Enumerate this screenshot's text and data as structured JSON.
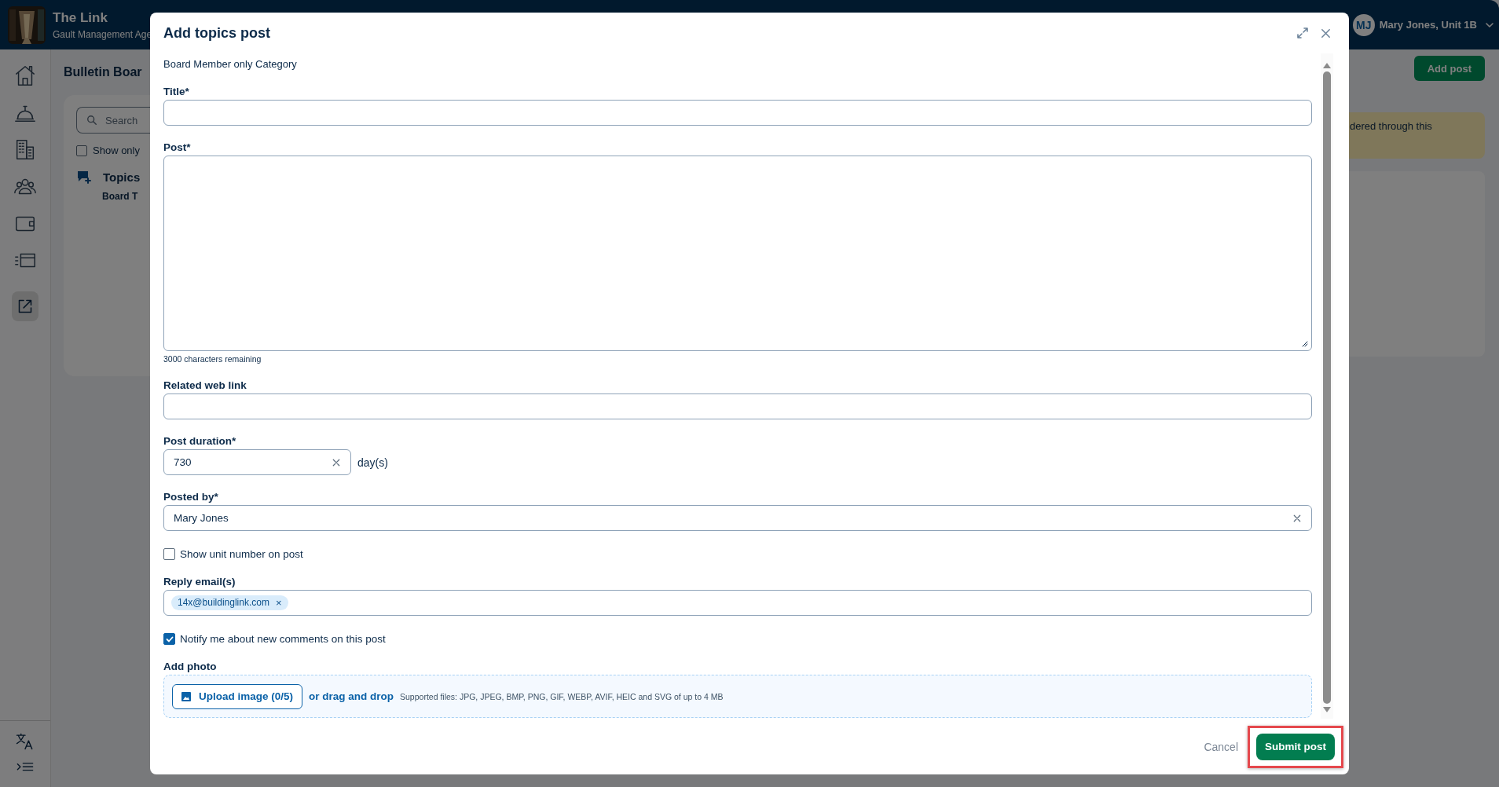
{
  "app": {
    "name": "The Link",
    "company": "Gault Management Age",
    "user": {
      "initials": "MJ",
      "name": "Mary Jones, Unit 1B"
    }
  },
  "sidebar": {
    "items": [
      {
        "kind": "home",
        "selected": false
      },
      {
        "kind": "bell",
        "selected": false
      },
      {
        "kind": "building",
        "selected": false
      },
      {
        "kind": "people",
        "selected": false
      },
      {
        "kind": "wallet",
        "selected": false
      },
      {
        "kind": "list",
        "selected": false
      },
      {
        "kind": "external",
        "selected": true
      }
    ],
    "footer": [
      {
        "kind": "translate"
      },
      {
        "kind": "collapse"
      }
    ]
  },
  "page": {
    "title": "Bulletin Boar",
    "search": {
      "placeholder": "Search"
    },
    "filter": {
      "label": "Show only",
      "checked": false
    },
    "section": {
      "title": "Topics",
      "item": "Board T"
    },
    "add_button": "Add post",
    "notice": "dered through this"
  },
  "dialog": {
    "title": "Add topics post",
    "category": "Board Member only Category",
    "fields": [
      {
        "kind": "text",
        "label": "Title*"
      },
      {
        "kind": "textarea",
        "label": "Post*",
        "counter": "3000 characters remaining"
      },
      {
        "kind": "text",
        "label": "Related web link"
      },
      {
        "kind": "duration",
        "label": "Post duration*",
        "value": "730",
        "unit": "day(s)"
      },
      {
        "kind": "select",
        "label": "Posted by*",
        "value": "Mary Jones"
      },
      {
        "kind": "checkbox",
        "label": "Show unit number on post",
        "checked": false
      },
      {
        "kind": "tags",
        "label": "Reply email(s)",
        "tags": [
          {
            "text": "14x@buildinglink.com",
            "remove": "×"
          }
        ]
      },
      {
        "kind": "checkbox",
        "label": "Notify me about new comments on this post",
        "checked": true
      },
      {
        "label": "Add photo",
        "button": "Upload image (0/5)",
        "link": "or drag and drop",
        "note": "Supported files: JPG, JPEG, BMP, PNG, GIF, WEBP, AVIF, HEIC and SVG of up to 4 MB"
      }
    ],
    "footer": {
      "cancel": "Cancel",
      "submit": {
        "label": "Submit post",
        "highlighted": true
      }
    }
  }
}
